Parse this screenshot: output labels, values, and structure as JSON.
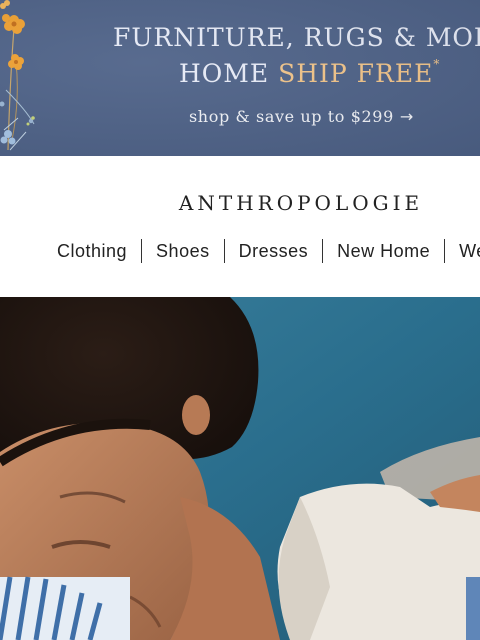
{
  "promo": {
    "headline_line1": "FURNITURE, RUGS & MORE",
    "headline_line2_start": "HOME",
    "headline_line2_accent": "SHIP FREE",
    "asterisk": "*",
    "cta": "shop & save up to $299",
    "cta_arrow": "→",
    "colors": {
      "background": "#4e6288",
      "accent": "#f2c58a",
      "text": "#e8ecf8"
    }
  },
  "header": {
    "logo": "ANTHROPOLOGIE"
  },
  "nav": {
    "items": [
      {
        "label": "Clothing"
      },
      {
        "label": "Shoes"
      },
      {
        "label": "Dresses"
      },
      {
        "label": "New Home"
      },
      {
        "label": "We"
      }
    ]
  },
  "hero": {
    "icon": "hero-photo"
  }
}
